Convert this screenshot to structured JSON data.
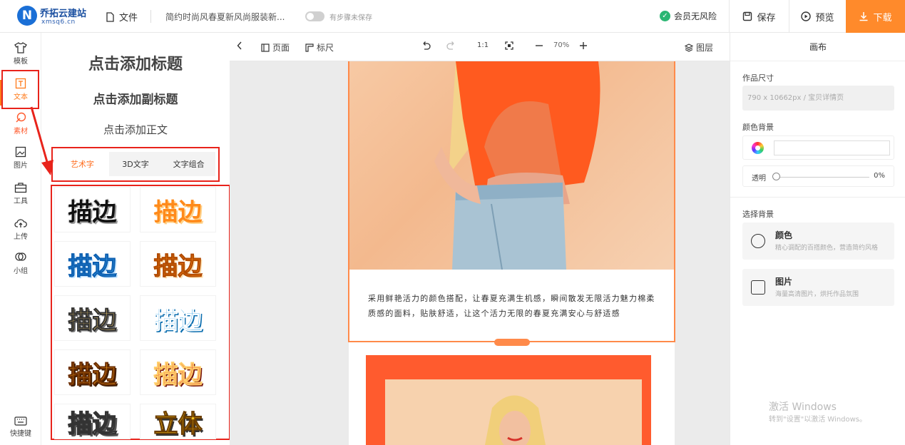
{
  "header": {
    "logo_letter": "N",
    "logo_name": "乔拓云建站",
    "logo_sub": "xmsq6.cn",
    "file_label": "文件",
    "doc_title": "简约时尚风春夏新风尚服装新...",
    "autosave_label": "有步骤未保存",
    "member_label": "会员无风险",
    "save_label": "保存",
    "preview_label": "预览",
    "download_label": "下载"
  },
  "leftnav": {
    "items": [
      {
        "label": "模板",
        "icon": "tshirt-icon"
      },
      {
        "label": "文本",
        "icon": "text-icon"
      },
      {
        "label": "素材",
        "icon": "material-icon"
      },
      {
        "label": "图片",
        "icon": "image-icon"
      },
      {
        "label": "工具",
        "icon": "toolbox-icon"
      },
      {
        "label": "上传",
        "icon": "upload-icon"
      },
      {
        "label": "小组",
        "icon": "group-icon"
      }
    ],
    "shortcut_label": "快捷键",
    "active_color": "#ff7a1a"
  },
  "panel": {
    "add_title": "点击添加标题",
    "add_subtitle": "点击添加副标题",
    "add_body": "点击添加正文",
    "tabs": [
      "艺术字",
      "3D文字",
      "文字组合"
    ],
    "active_tab": "艺术字",
    "styles": [
      "描边",
      "描边",
      "描边",
      "描边",
      "描边",
      "描边",
      "描边",
      "描边",
      "描边",
      "立体"
    ]
  },
  "toolbar": {
    "page_label": "页面",
    "ruler_label": "标尺",
    "ratio_label": "1:1",
    "zoom": "70%",
    "layers_label": "图层"
  },
  "canvas": {
    "paragraph": "采用鲜艳活力的颜色搭配，让春夏充满生机感，瞬间散发无限活力魅力棉柔质感的面料，贴肤舒适，让这个活力无限的春夏充满安心与舒适感"
  },
  "rightpanel": {
    "heading": "画布",
    "size_label": "作品尺寸",
    "size_value": "790 x 10662px   / 宝贝详情页",
    "color_bg_label": "颜色背景",
    "opacity_label": "透明",
    "opacity_value": "0%",
    "choose_bg_label": "选择背景",
    "bg_options": [
      {
        "title": "颜色",
        "desc": "精心调配的百搭颜色，营造简约风格"
      },
      {
        "title": "图片",
        "desc": "海量高清图片，烘托作品氛围"
      }
    ],
    "watermark_title": "激活 Windows",
    "watermark_sub": "转到\"设置\"以激活 Windows。"
  },
  "colors": {
    "accent": "#ff8a2b",
    "highlight_red": "#e8231b",
    "poster_orange": "#ff5b2e"
  }
}
